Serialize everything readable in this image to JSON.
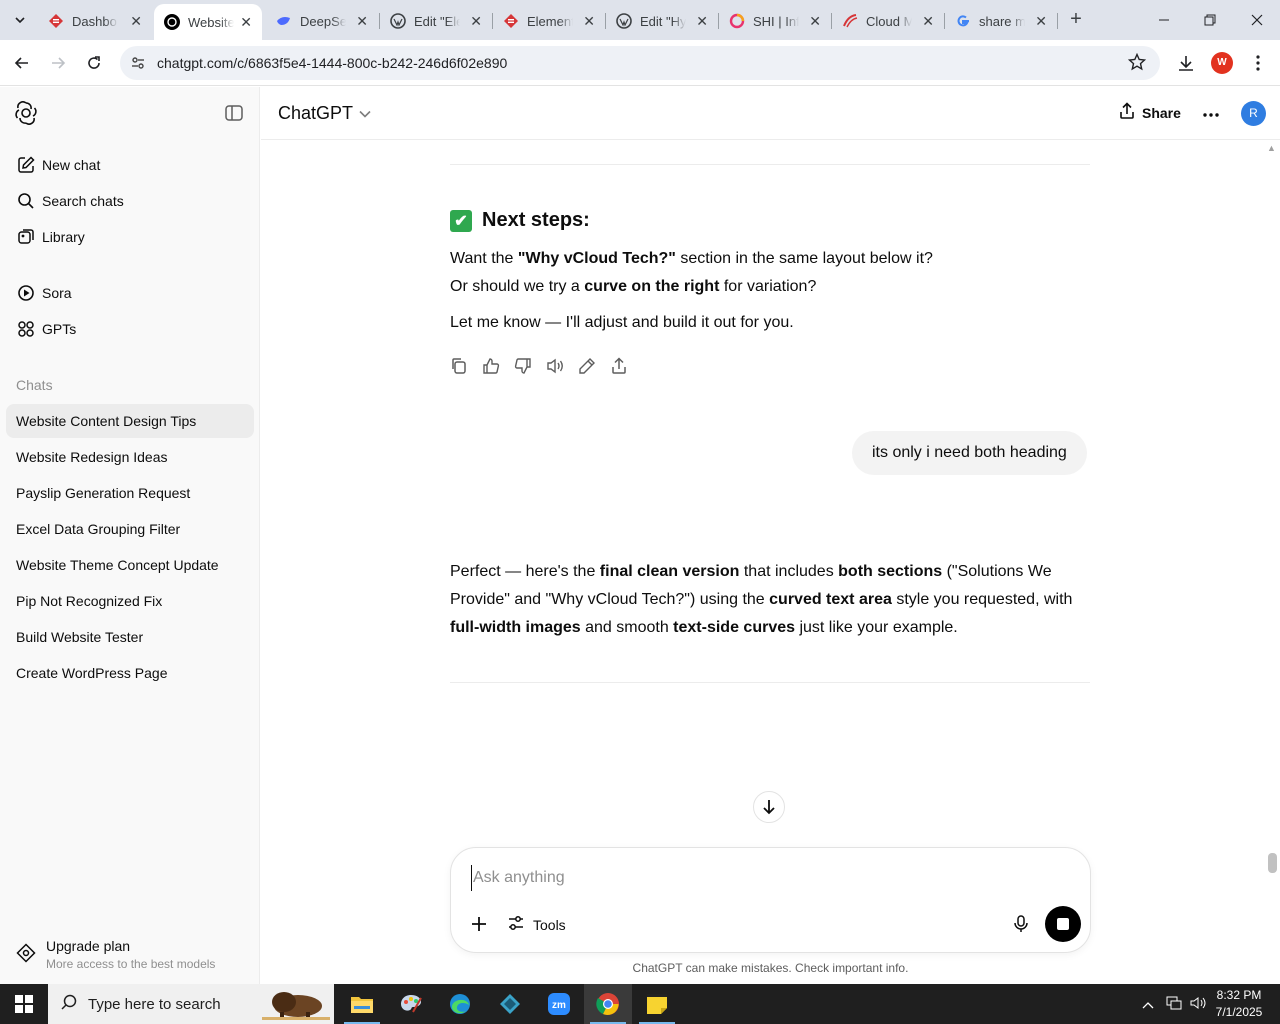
{
  "browser": {
    "tabs": [
      {
        "title": "Dashbo",
        "icon": "elementor-icon",
        "color": "#d63638"
      },
      {
        "title": "Website",
        "icon": "chatgpt-icon",
        "active": true
      },
      {
        "title": "DeepSe",
        "icon": "deepseek-icon",
        "color": "#4d6bfe"
      },
      {
        "title": "Edit \"Ele",
        "icon": "wordpress-icon"
      },
      {
        "title": "Element",
        "icon": "elementor-icon",
        "color": "#d63638"
      },
      {
        "title": "Edit \"Hy",
        "icon": "wordpress-icon"
      },
      {
        "title": "SHI | Inf",
        "icon": "shi-icon"
      },
      {
        "title": "Cloud M",
        "icon": "cloud-icon",
        "color": "#d63638"
      },
      {
        "title": "share m",
        "icon": "google-icon"
      }
    ],
    "url": "chatgpt.com/c/6863f5e4-1444-800c-b242-246d6f02e890",
    "profile_letter": "W"
  },
  "sidebar": {
    "nav": [
      {
        "label": "New chat",
        "icon": "new-chat-icon"
      },
      {
        "label": "Search chats",
        "icon": "search-icon"
      },
      {
        "label": "Library",
        "icon": "library-icon"
      },
      {
        "label": "Sora",
        "icon": "sora-icon"
      },
      {
        "label": "GPTs",
        "icon": "gpts-icon"
      }
    ],
    "chats_heading": "Chats",
    "chats": [
      "Website Content Design Tips",
      "Website Redesign Ideas",
      "Payslip Generation Request",
      "Excel Data Grouping Filter",
      "Website Theme Concept Update",
      "Pip Not Recognized Fix",
      "Build Website Tester",
      "Create WordPress Page"
    ],
    "upgrade": {
      "title": "Upgrade plan",
      "subtitle": "More access to the best models"
    }
  },
  "header": {
    "model": "ChatGPT",
    "share": "Share",
    "avatar_letter": "R"
  },
  "conversation": {
    "next_steps_heading": "Next steps:",
    "assistant_1": {
      "p1_a": "Want the ",
      "p1_b": "\"Why vCloud Tech?\"",
      "p1_c": " section in the same layout below it?",
      "p2_a": "Or should we try a ",
      "p2_b": "curve on the right",
      "p2_c": " for variation?",
      "p3": "Let me know — I'll adjust and build it out for you."
    },
    "user_message": "its only i need both heading",
    "assistant_2": {
      "t1": "Perfect — here's the ",
      "b1": "final clean version",
      "t2": " that includes ",
      "b2": "both sections",
      "t3": " (\"Solutions We Provide\" and \"Why vCloud Tech?\") using the ",
      "b3": "curved text area",
      "t4": " style you requested, with ",
      "b4": "full-width images",
      "t5": " and smooth ",
      "b5": "text-side curves",
      "t6": " just like your example."
    }
  },
  "composer": {
    "placeholder": "Ask anything",
    "tools_label": "Tools",
    "disclaimer": "ChatGPT can make mistakes. Check important info."
  },
  "taskbar": {
    "search_placeholder": "Type here to search",
    "time": "8:32 PM",
    "date": "7/1/2025"
  }
}
